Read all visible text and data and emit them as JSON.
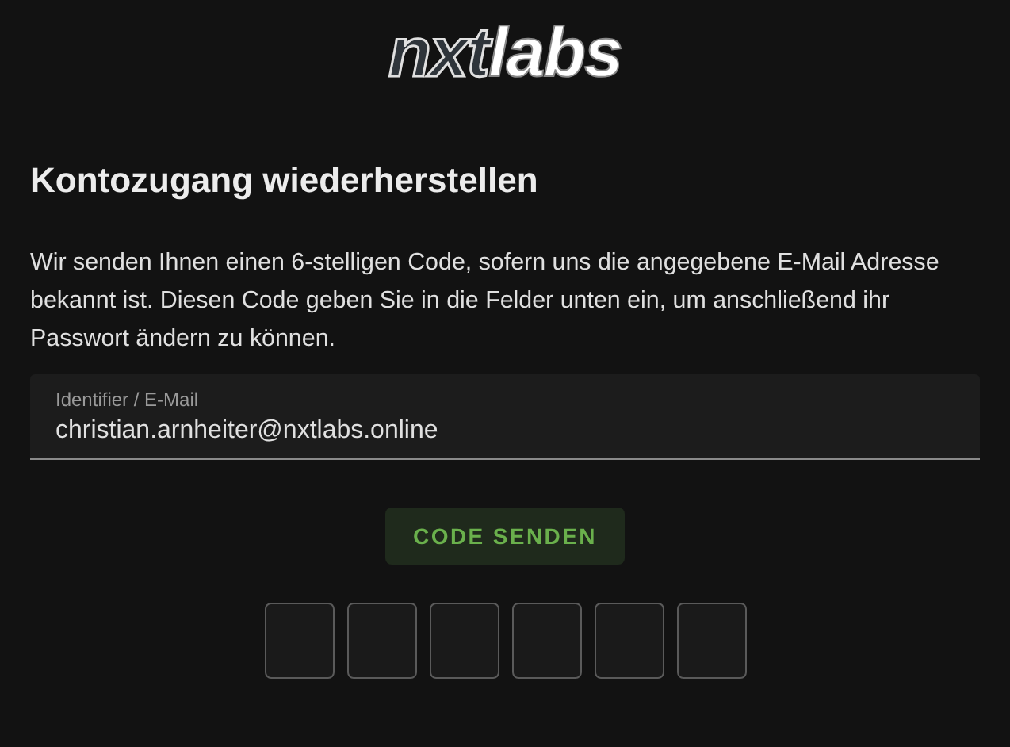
{
  "logo": {
    "part_1": "nxt",
    "part_2": "labs"
  },
  "title": "Kontozugang wiederherstellen",
  "description": "Wir senden Ihnen einen 6-stelligen Code, sofern uns die angegebene E-Mail Adresse bekannt ist. Diesen Code geben Sie in die Felder unten ein, um anschließend ihr Passwort ändern zu können.",
  "identifier_field": {
    "label": "Identifier / E-Mail",
    "value": "christian.arnheiter@nxtlabs.online"
  },
  "send_button": "CODE SENDEN",
  "code_fields": [
    {
      "kind": "digit"
    },
    {
      "kind": "digit"
    },
    {
      "kind": "digit"
    },
    {
      "kind": "digit"
    },
    {
      "kind": "digit"
    },
    {
      "kind": "digit"
    }
  ]
}
